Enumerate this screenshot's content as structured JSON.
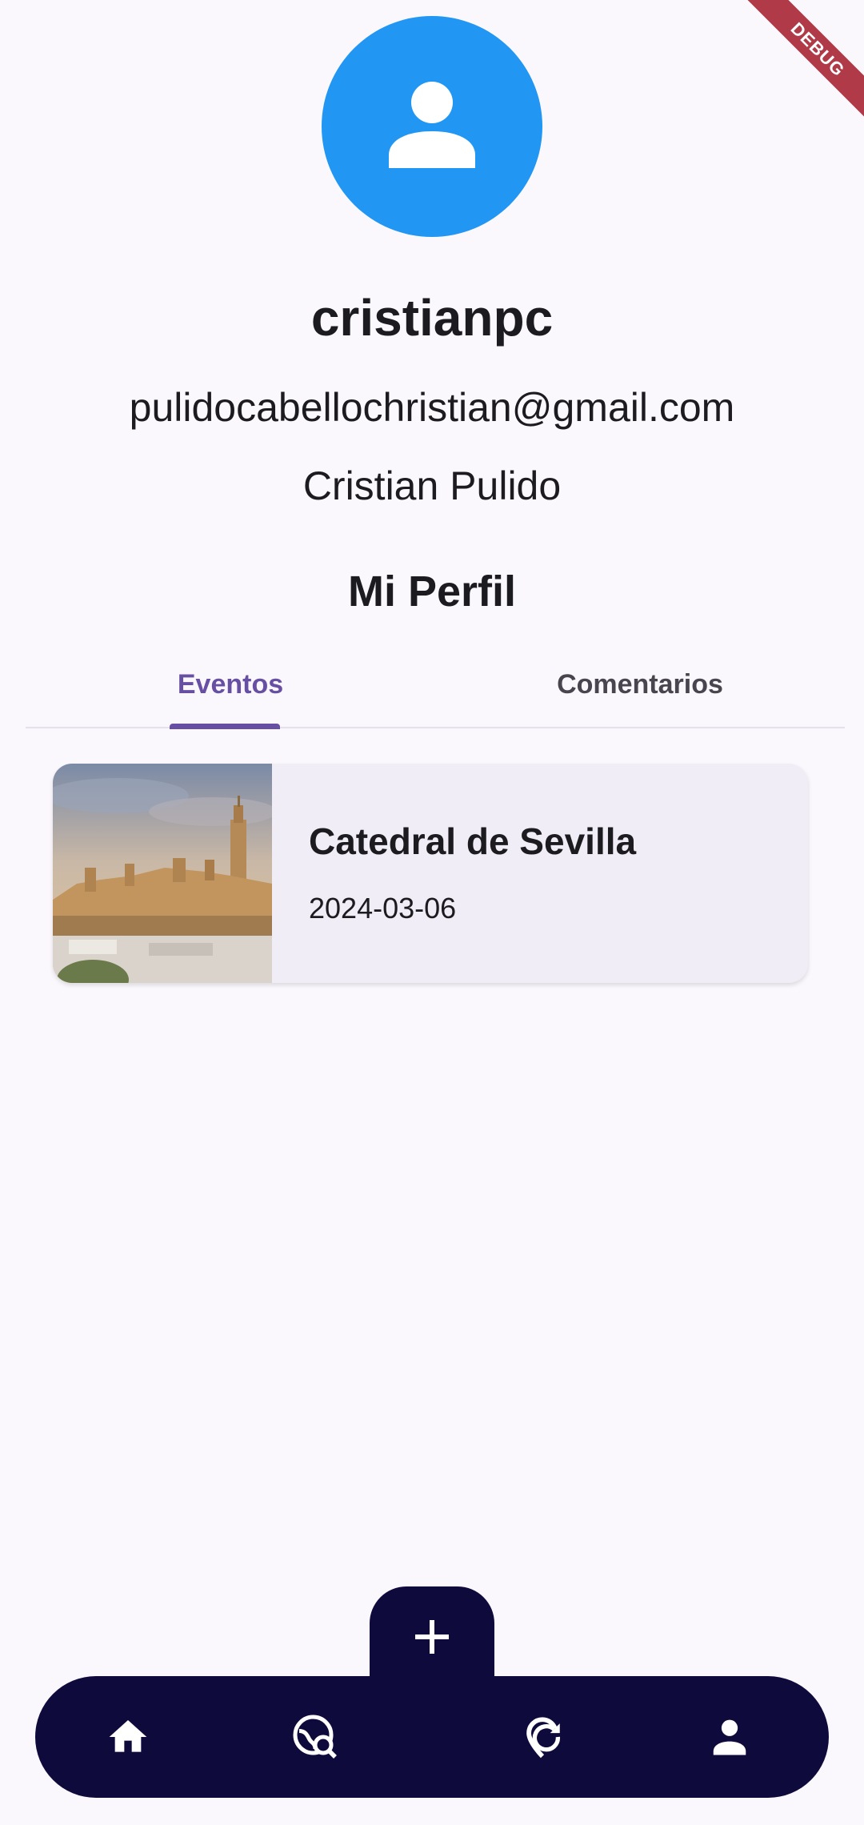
{
  "debug_banner": "DEBUG",
  "profile": {
    "username": "cristianpc",
    "email": "pulidocabellochristian@gmail.com",
    "full_name": "Cristian Pulido",
    "section_title": "Mi Perfil"
  },
  "tabs": [
    {
      "label": "Eventos",
      "active": true
    },
    {
      "label": "Comentarios",
      "active": false
    }
  ],
  "events": [
    {
      "name": "Catedral de Sevilla",
      "date": "2024-03-06",
      "image": "seville-cathedral-photo"
    }
  ],
  "bottom_nav": {
    "items": [
      {
        "icon": "home-icon"
      },
      {
        "icon": "explore-search-icon"
      },
      {
        "icon": "refresh-location-icon"
      },
      {
        "icon": "person-icon"
      }
    ],
    "fab_icon": "add-icon"
  },
  "colors": {
    "accent": "#6750a4",
    "avatar": "#2196f3",
    "nav_background": "#0f0a3c",
    "debug_ribbon": "#b03a48"
  }
}
